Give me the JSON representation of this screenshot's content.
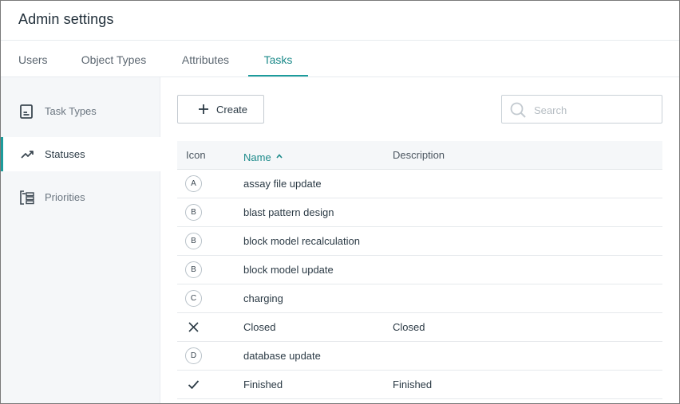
{
  "header": {
    "title": "Admin settings"
  },
  "tabs": [
    {
      "label": "Users"
    },
    {
      "label": "Object Types"
    },
    {
      "label": "Attributes"
    },
    {
      "label": "Tasks",
      "active": true
    }
  ],
  "sidebar": {
    "items": [
      {
        "label": "Task Types",
        "icon": "task-types-icon"
      },
      {
        "label": "Statuses",
        "icon": "trend-line-icon",
        "active": true
      },
      {
        "label": "Priorities",
        "icon": "priorities-icon"
      }
    ]
  },
  "toolbar": {
    "create_label": "Create",
    "search_placeholder": "Search"
  },
  "table": {
    "columns": {
      "icon": "Icon",
      "name": "Name",
      "description": "Description"
    },
    "sort": {
      "column": "Name",
      "direction": "ascending"
    },
    "rows": [
      {
        "icon": "A",
        "name": "assay file update",
        "description": ""
      },
      {
        "icon": "B",
        "name": "blast pattern design",
        "description": ""
      },
      {
        "icon": "B",
        "name": "block model recalculation",
        "description": ""
      },
      {
        "icon": "B",
        "name": "block model update",
        "description": ""
      },
      {
        "icon": "C",
        "name": "charging",
        "description": ""
      },
      {
        "icon": "close-icon",
        "name": "Closed",
        "description": "Closed"
      },
      {
        "icon": "D",
        "name": "database update",
        "description": ""
      },
      {
        "icon": "checkmark-icon",
        "name": "Finished",
        "description": "Finished"
      }
    ]
  },
  "colors": {
    "accent": "#1c9c9c",
    "sidebar_bg": "#f5f7f9",
    "text": "#2b3a45"
  }
}
